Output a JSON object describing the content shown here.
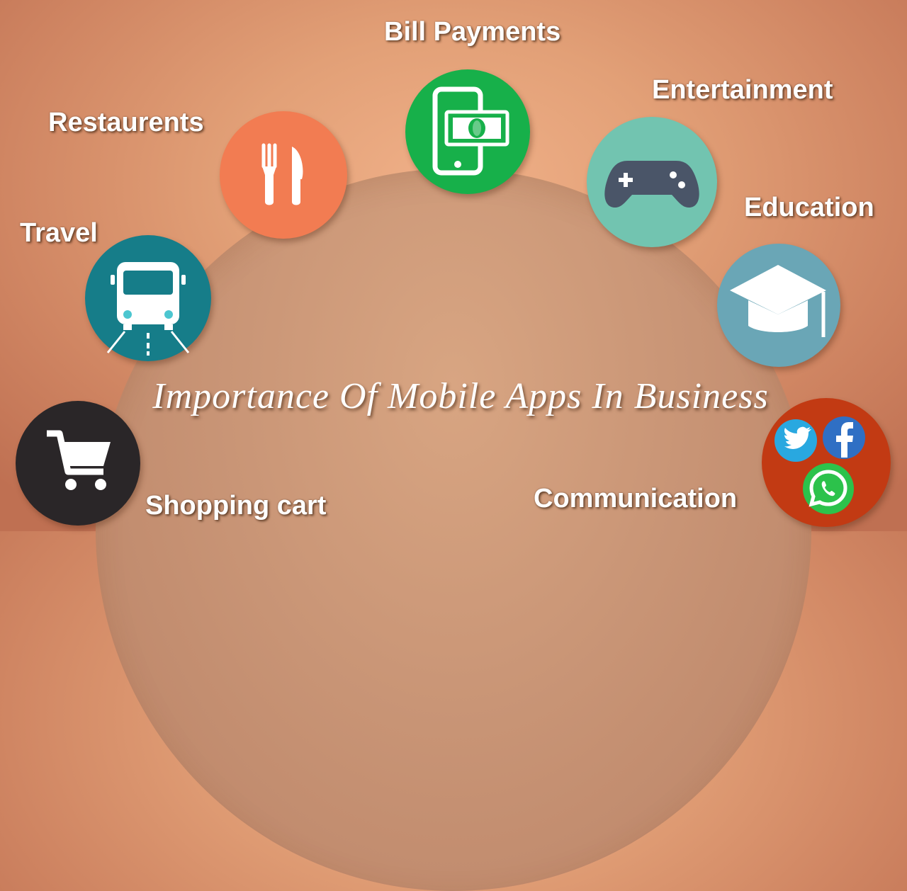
{
  "title": "Importance Of Mobile Apps In Business",
  "categories": {
    "bill_payments": "Bill Payments",
    "entertainment": "Entertainment",
    "restaurants": "Restaurents",
    "education": "Education",
    "travel": "Travel",
    "shopping_cart": "Shopping cart",
    "communication": "Communication"
  },
  "icons": {
    "bill_payments": "phone-money-icon",
    "entertainment": "gamepad-icon",
    "restaurants": "fork-knife-icon",
    "education": "graduation-cap-icon",
    "travel": "bus-icon",
    "shopping_cart": "cart-icon",
    "communication": [
      "twitter-icon",
      "facebook-icon",
      "whatsapp-icon"
    ]
  },
  "colors": {
    "bill_payments": "#17b04a",
    "entertainment": "#72c4b0",
    "restaurants": "#f27c52",
    "education": "#6aa6b6",
    "travel": "#167d89",
    "shopping_cart": "#2a2628",
    "communication": "#c23a13",
    "twitter": "#29a8e0",
    "facebook": "#2f6fc4",
    "whatsapp": "#2cc24b"
  }
}
